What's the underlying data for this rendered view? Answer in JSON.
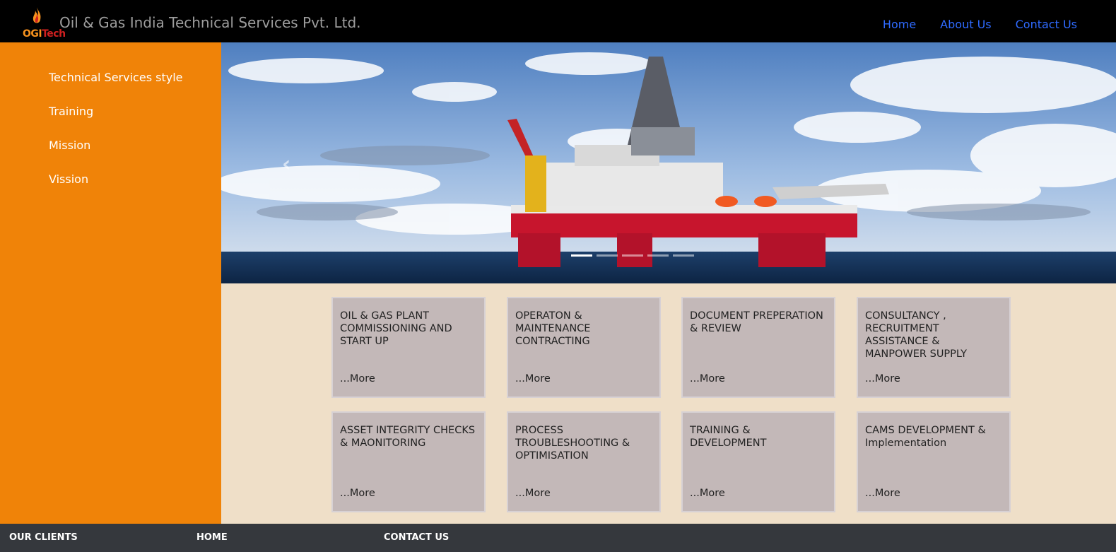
{
  "header": {
    "logo_text_ogi": "OGI",
    "logo_text_tech": "Tech",
    "brand": "Oil & Gas India Technical Services Pvt. Ltd.",
    "nav": [
      "Home",
      "About Us",
      "Contact Us"
    ]
  },
  "sidebar": {
    "items": [
      "Technical Services style",
      "Training",
      "Mission",
      "Vission"
    ]
  },
  "carousel": {
    "prev_icon": "chevron-left-icon",
    "prev_glyph": "‹",
    "slide_count": 5,
    "active_index": 0
  },
  "cards": [
    {
      "title": "OIL & GAS PLANT COMMISSIONING AND START UP",
      "more": "...More"
    },
    {
      "title": "OPERATON & MAINTENANCE CONTRACTING",
      "more": "...More"
    },
    {
      "title": "DOCUMENT PREPERATION & REVIEW",
      "more": "...More"
    },
    {
      "title": "CONSULTANCY , RECRUITMENT ASSISTANCE & MANPOWER SUPPLY",
      "more": "...More"
    },
    {
      "title": "ASSET INTEGRITY CHECKS & MAONITORING",
      "more": "...More"
    },
    {
      "title": "PROCESS TROUBLESHOOTING & OPTIMISATION",
      "more": "...More"
    },
    {
      "title": "TRAINING & DEVELOPMENT",
      "more": "...More"
    },
    {
      "title": "CAMS DEVELOPMENT & Implementation",
      "more": "...More"
    }
  ],
  "footer": {
    "links": [
      "OUR CLIENTS",
      "HOME",
      "CONTACT US"
    ]
  },
  "colors": {
    "sidebar": "#f08308",
    "nav_link": "#2f6bff",
    "content_bg": "#efdfc8",
    "card_bg": "#c3b8b8",
    "footer_bg": "#35383d"
  }
}
